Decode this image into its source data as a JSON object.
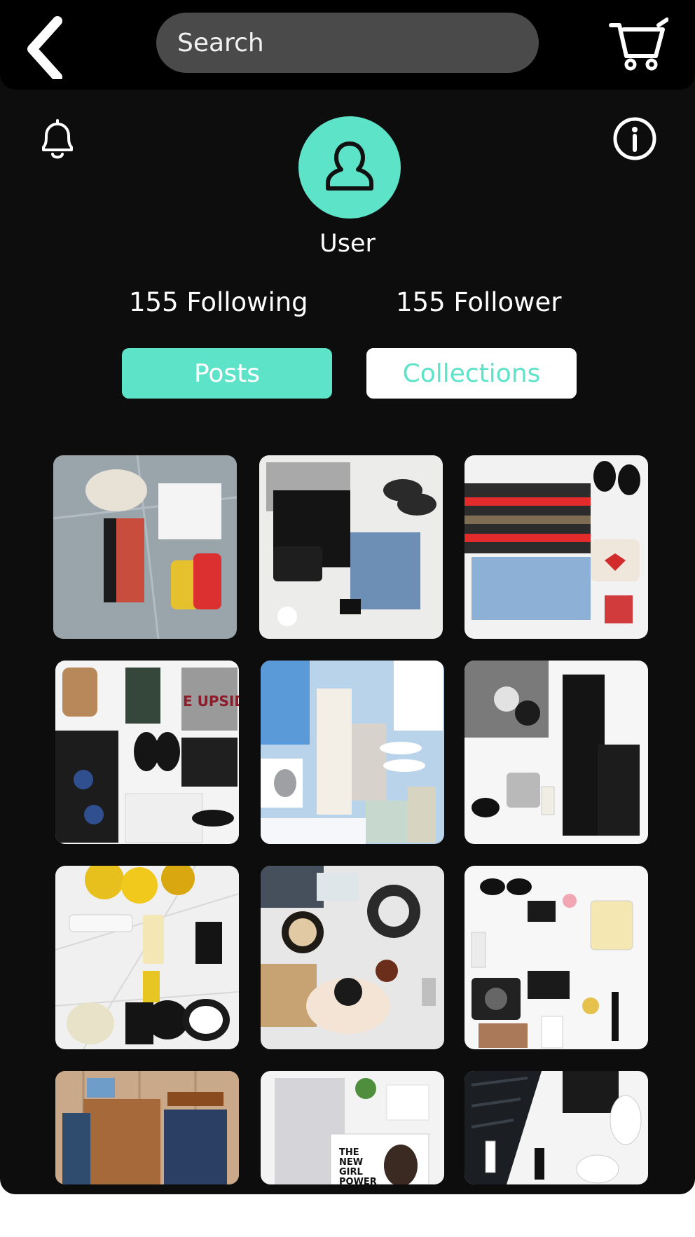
{
  "topbar": {
    "search_placeholder": "Search"
  },
  "profile": {
    "username": "User",
    "following": "155 Following",
    "follower": "155 Follower"
  },
  "tabs": {
    "posts": "Posts",
    "collections": "Collections"
  },
  "colors": {
    "accent": "#5de3c8",
    "background": "#0d0d0d",
    "topbar": "#000000",
    "search_bg": "#4a4a4a"
  },
  "icons": {
    "back": "chevron-left-icon",
    "cart": "cart-icon",
    "notifications": "bell-icon",
    "info": "info-icon",
    "avatar": "user-icon"
  },
  "posts": [
    {
      "row": 0,
      "col": 0
    },
    {
      "row": 0,
      "col": 1
    },
    {
      "row": 0,
      "col": 2
    },
    {
      "row": 1,
      "col": 0
    },
    {
      "row": 1,
      "col": 1
    },
    {
      "row": 1,
      "col": 2
    },
    {
      "row": 2,
      "col": 0
    },
    {
      "row": 2,
      "col": 1
    },
    {
      "row": 2,
      "col": 2
    },
    {
      "row": 3,
      "col": 0
    },
    {
      "row": 3,
      "col": 1
    },
    {
      "row": 3,
      "col": 2
    }
  ]
}
